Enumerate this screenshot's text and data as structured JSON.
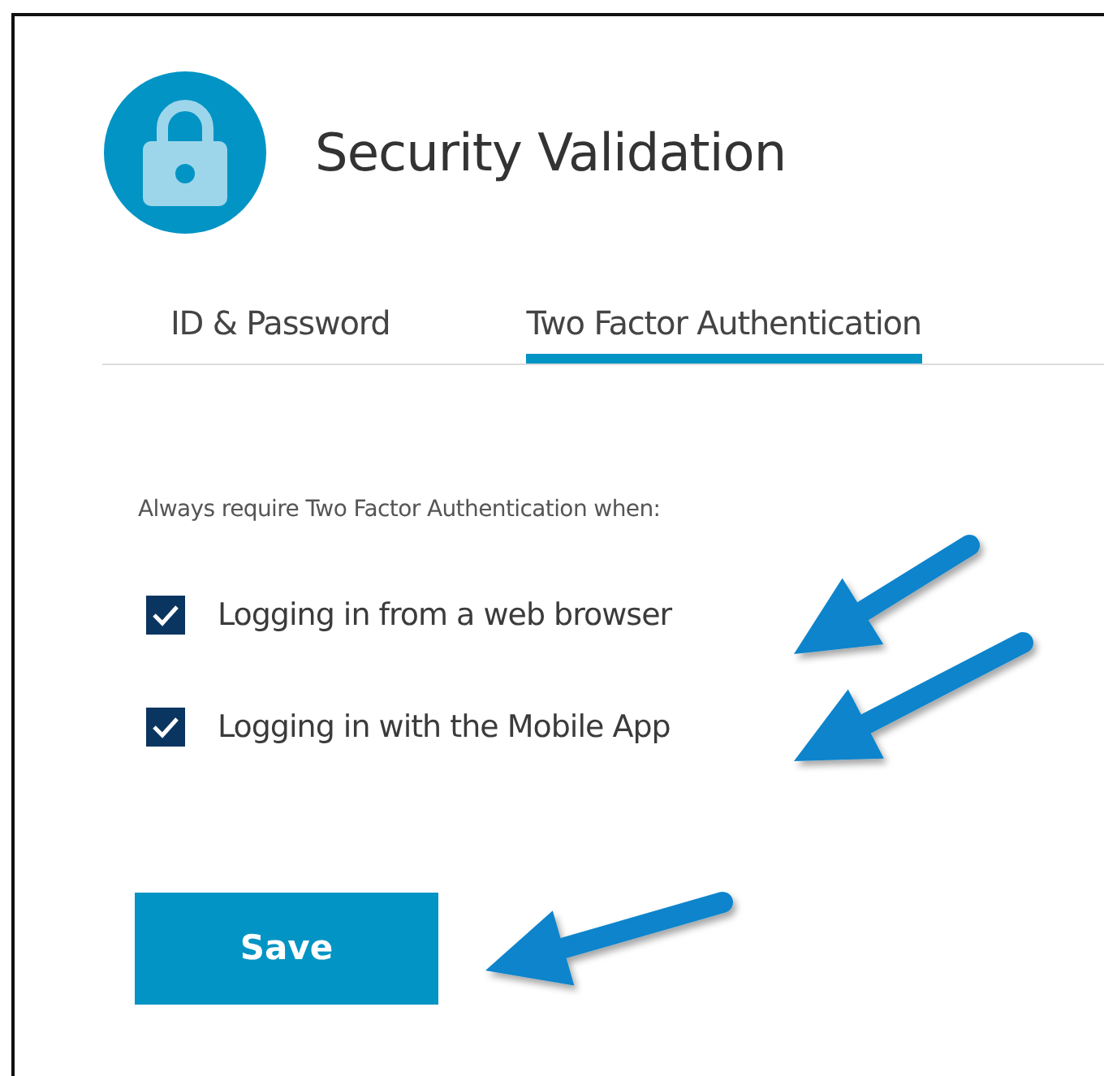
{
  "header": {
    "title": "Security Validation"
  },
  "tabs": [
    {
      "label": "ID & Password",
      "selected": false
    },
    {
      "label": "Two Factor Authentication",
      "selected": true
    }
  ],
  "instruction": "Always require Two Factor Authentication when:",
  "options": [
    {
      "label": "Logging in from a web browser",
      "checked": true
    },
    {
      "label": "Logging in with the Mobile App",
      "checked": true
    }
  ],
  "buttons": [
    {
      "label": "Save"
    }
  ]
}
